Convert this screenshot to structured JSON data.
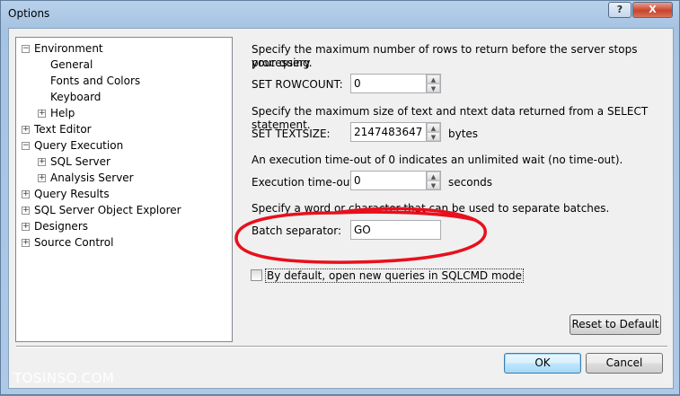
{
  "window": {
    "title": "Options",
    "help_label": "?",
    "close_label": "X"
  },
  "tree": [
    {
      "label": "Environment",
      "expander": "−",
      "indent": 0
    },
    {
      "label": "General",
      "expander": "",
      "indent": 1
    },
    {
      "label": "Fonts and Colors",
      "expander": "",
      "indent": 1
    },
    {
      "label": "Keyboard",
      "expander": "",
      "indent": 1
    },
    {
      "label": "Help",
      "expander": "+",
      "indent": 1
    },
    {
      "label": "Text Editor",
      "expander": "+",
      "indent": 0
    },
    {
      "label": "Query Execution",
      "expander": "−",
      "indent": 0
    },
    {
      "label": "SQL Server",
      "expander": "+",
      "indent": 1
    },
    {
      "label": "Analysis Server",
      "expander": "+",
      "indent": 1
    },
    {
      "label": "Query Results",
      "expander": "+",
      "indent": 0
    },
    {
      "label": "SQL Server Object Explorer",
      "expander": "+",
      "indent": 0
    },
    {
      "label": "Designers",
      "expander": "+",
      "indent": 0
    },
    {
      "label": "Source Control",
      "expander": "+",
      "indent": 0
    }
  ],
  "settings": {
    "rowcount_desc_1": "Specify the maximum number of rows to return before the server stops processing",
    "rowcount_desc_2": "your query.",
    "rowcount_label": "SET ROWCOUNT:",
    "rowcount_value": "0",
    "textsize_desc": "Specify the maximum size of text and ntext data returned from a SELECT statement.",
    "textsize_label": "SET TEXTSIZE:",
    "textsize_value": "2147483647",
    "textsize_unit": "bytes",
    "timeout_desc": "An execution time-out of 0 indicates an unlimited wait (no time-out).",
    "timeout_label": "Execution time-out:",
    "timeout_value": "0",
    "timeout_unit": "seconds",
    "batch_desc": "Specify a word or character that can be used to separate batches.",
    "batch_label": "Batch separator:",
    "batch_value": "GO",
    "sqlcmd_label": "By default, open new queries in SQLCMD mode",
    "sqlcmd_checked": false
  },
  "buttons": {
    "reset": "Reset to Default",
    "ok": "OK",
    "cancel": "Cancel"
  },
  "annotation_color": "#e8101c",
  "watermark": "TOSINSO.COM"
}
